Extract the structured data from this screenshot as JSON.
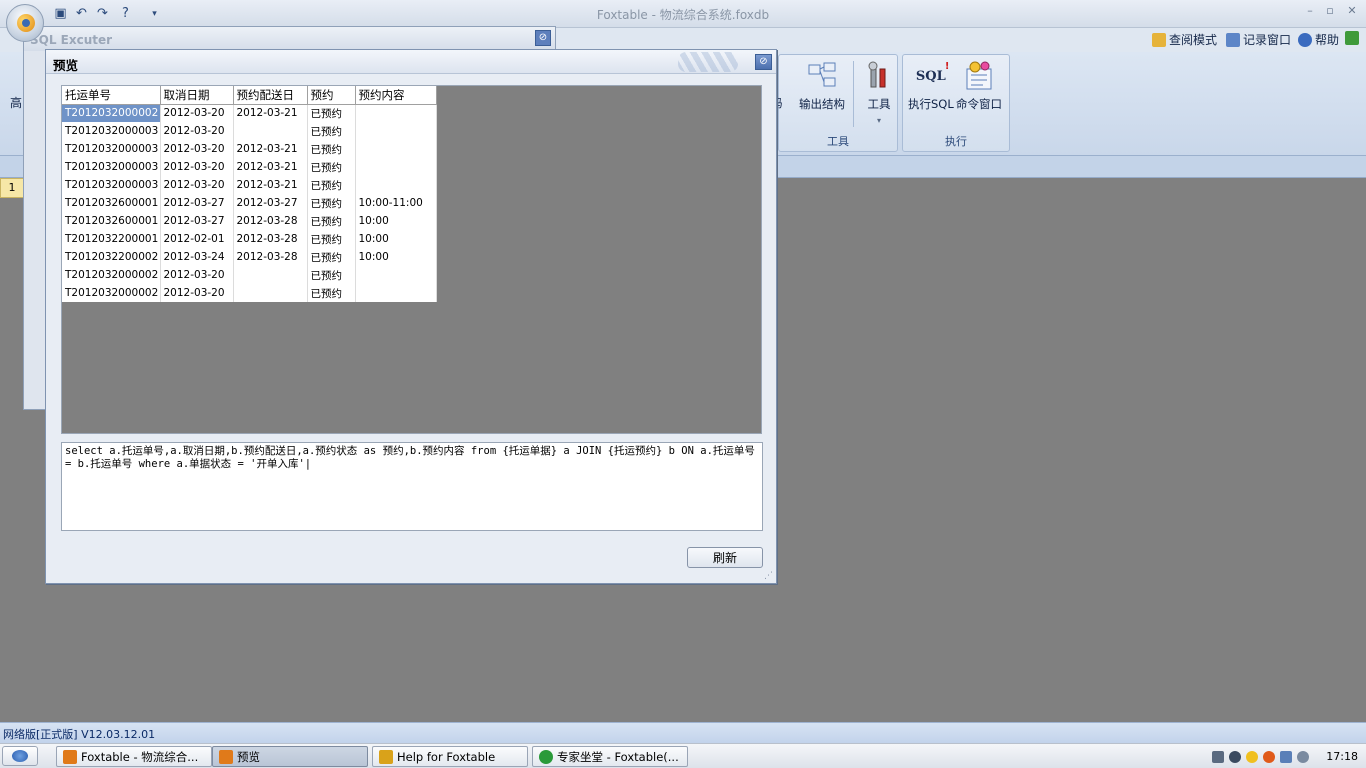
{
  "app": {
    "title": "Foxtable - 物流综合系统.foxdb",
    "quick_access": [
      "save",
      "undo",
      "redo",
      "help",
      "customize"
    ],
    "window_controls": {
      "minimize": "–",
      "restore": "▫",
      "close": "✕"
    }
  },
  "top_menu": {
    "view_mode": "查阅模式",
    "record_window": "记录窗口",
    "help": "帮助"
  },
  "ribbon": {
    "left_partial_label": "高",
    "tools_group": {
      "label": "工具",
      "buttons": [
        {
          "label": "码",
          "icon": "code-icon"
        },
        {
          "label": "输出结构",
          "icon": "export-structure-icon"
        },
        {
          "label": "工具",
          "icon": "tools-icon"
        }
      ]
    },
    "exec_group": {
      "label": "执行",
      "buttons": [
        {
          "label": "执行SQL",
          "icon": "sql-icon",
          "icon_text": "SQL"
        },
        {
          "label": "命令窗口",
          "icon": "command-window-icon"
        }
      ]
    },
    "row_number": "1"
  },
  "sql_window": {
    "title": "SQL Excuter",
    "close_glyph": "⊘"
  },
  "preview_dialog": {
    "title": "预览",
    "close_glyph": "⊘",
    "grid": {
      "columns": [
        "托运单号",
        "取消日期",
        "预约配送日",
        "预约",
        "预约内容"
      ],
      "selected_row": 0,
      "rows": [
        [
          "T2012032000002",
          "2012-03-20",
          "2012-03-21",
          "已预约",
          ""
        ],
        [
          "T2012032000003",
          "2012-03-20",
          "",
          "已预约",
          ""
        ],
        [
          "T2012032000003",
          "2012-03-20",
          "2012-03-21",
          "已预约",
          ""
        ],
        [
          "T2012032000003",
          "2012-03-20",
          "2012-03-21",
          "已预约",
          ""
        ],
        [
          "T2012032000003",
          "2012-03-20",
          "2012-03-21",
          "已预约",
          ""
        ],
        [
          "T2012032600001",
          "2012-03-27",
          "2012-03-27",
          "已预约",
          "10:00-11:00"
        ],
        [
          "T2012032600001",
          "2012-03-27",
          "2012-03-28",
          "已预约",
          "10:00"
        ],
        [
          "T2012032200001",
          "2012-02-01",
          "2012-03-28",
          "已预约",
          "10:00"
        ],
        [
          "T2012032200002",
          "2012-03-24",
          "2012-03-28",
          "已预约",
          "10:00"
        ],
        [
          "T2012032000002",
          "2012-03-20",
          "",
          "已预约",
          ""
        ],
        [
          "T2012032000002",
          "2012-03-20",
          "",
          "已预约",
          ""
        ]
      ]
    },
    "sql_text": "select a.托运单号,a.取消日期,b.预约配送日,a.预约状态 as 预约,b.预约内容 from {托运单据} a JOIN {托运预约} b ON a.托运单号 = b.托运单号 where a.单据状态 = '开单入库'|",
    "refresh_label": "刷新"
  },
  "status_bar": {
    "text": "网络版[正式版] V12.03.12.01"
  },
  "taskbar": {
    "tasks": [
      {
        "label": "Foxtable - 物流综合...",
        "active": false,
        "color": "#e07a1a"
      },
      {
        "label": "预览",
        "active": true,
        "color": "#e07a1a"
      },
      {
        "label": "Help for Foxtable",
        "active": false,
        "color": "#d9a21a"
      },
      {
        "label": "专家坐堂 - Foxtable(...",
        "active": false,
        "color": "#2a9a3a"
      }
    ],
    "clock": "17:18"
  }
}
